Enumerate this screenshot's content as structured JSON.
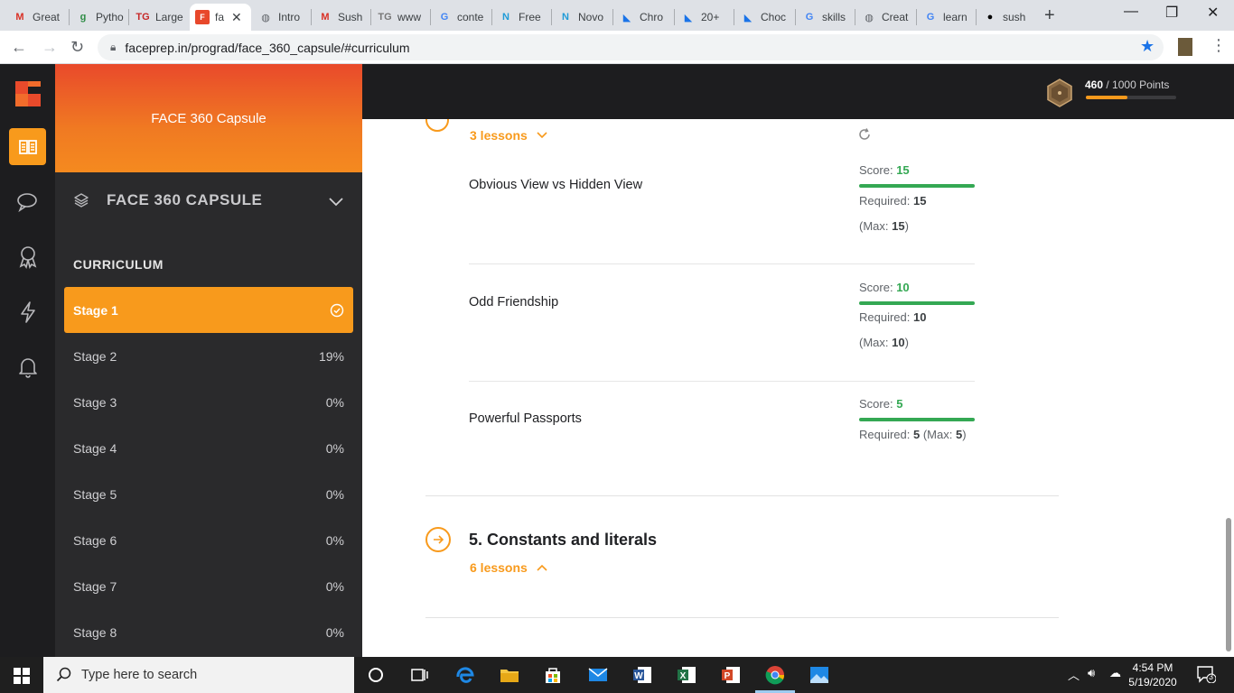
{
  "browser": {
    "tabs": [
      {
        "label": "Great",
        "icon": "gmail-icon"
      },
      {
        "label": "Pytho",
        "icon": "geeksforgeeks-icon"
      },
      {
        "label": "Large",
        "icon": "techgig-icon"
      },
      {
        "label": "fa",
        "icon": "faceprep-icon",
        "active": true
      },
      {
        "label": "Intro",
        "icon": "globe-icon"
      },
      {
        "label": "Sush",
        "icon": "gmail-icon"
      },
      {
        "label": "www",
        "icon": "techgig-icon"
      },
      {
        "label": "conte",
        "icon": "google-icon"
      },
      {
        "label": "Free",
        "icon": "naukri-icon"
      },
      {
        "label": "Novo",
        "icon": "naukri-icon"
      },
      {
        "label": "Chro",
        "icon": "flag-icon"
      },
      {
        "label": "20+",
        "icon": "flag-icon"
      },
      {
        "label": "Choc",
        "icon": "flag-icon"
      },
      {
        "label": "skills",
        "icon": "google-icon"
      },
      {
        "label": "Creat",
        "icon": "globe-icon"
      },
      {
        "label": "learn",
        "icon": "google-icon"
      },
      {
        "label": "sush",
        "icon": "github-icon"
      }
    ],
    "url": "faceprep.in/prograd/face_360_capsule/#curriculum"
  },
  "sidebar": {
    "header_title": "FACE 360 Capsule",
    "capsule_label": "FACE 360 CAPSULE",
    "curriculum_label": "CURRICULUM",
    "stages": [
      {
        "label": "Stage 1",
        "status": "",
        "active": true
      },
      {
        "label": "Stage 2",
        "status": "19%"
      },
      {
        "label": "Stage 3",
        "status": "0%"
      },
      {
        "label": "Stage 4",
        "status": "0%"
      },
      {
        "label": "Stage 5",
        "status": "0%"
      },
      {
        "label": "Stage 6",
        "status": "0%"
      },
      {
        "label": "Stage 7",
        "status": "0%"
      },
      {
        "label": "Stage 8",
        "status": "0%"
      }
    ]
  },
  "header": {
    "points_earned": "460",
    "points_total": "/ 1000 Points",
    "progress_fraction": 0.46,
    "accent": "#f89a1c"
  },
  "main": {
    "lessons_toggle_top": "3 lessons",
    "lessons": [
      {
        "title": "Obvious View vs Hidden View",
        "score_label": "Score: ",
        "score": "15",
        "required_label": "Required: ",
        "required": "15",
        "max_open": "(Max: ",
        "max": "15",
        "max_close": ")"
      },
      {
        "title": "Odd Friendship",
        "score_label": "Score: ",
        "score": "10",
        "required_label": "Required: ",
        "required": "10",
        "max_open": "(Max: ",
        "max": "10",
        "max_close": ")"
      },
      {
        "title": "Powerful Passports",
        "score_label": "Score: ",
        "score": "5",
        "required_label": "Required: ",
        "required": "5",
        "max_open": " (Max: ",
        "max": "5",
        "max_close": ")"
      }
    ],
    "module_title": "5. Constants and literals",
    "module_lessons": "6 lessons"
  },
  "taskbar": {
    "search_placeholder": "Type here to search",
    "time": "4:54 PM",
    "date": "5/19/2020",
    "notifications": "3"
  },
  "colors": {
    "brand_orange": "#f89a1c",
    "score_green": "#34a853",
    "dark_bg": "#1d1d1f"
  }
}
